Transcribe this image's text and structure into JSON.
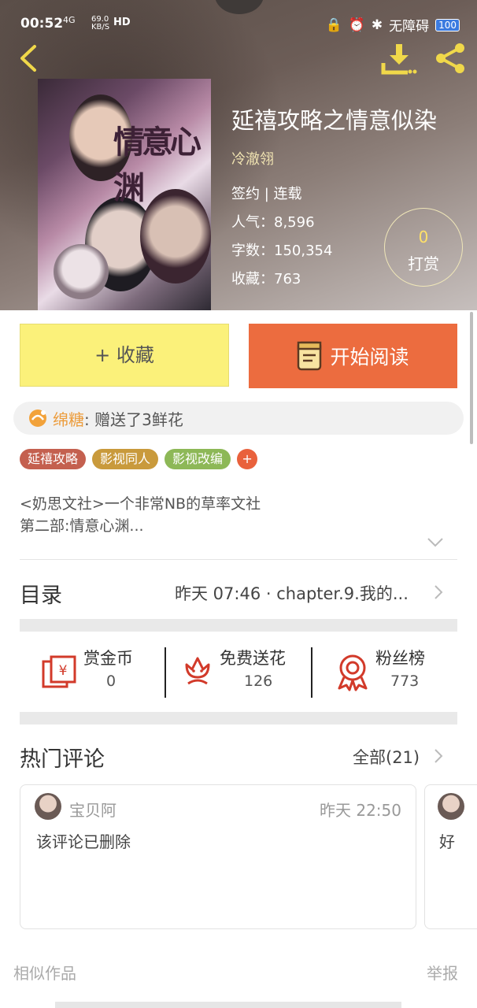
{
  "status_bar": {
    "time": "00:52",
    "network": "4G",
    "speed": "69.0\nKB/S",
    "hd": "HD",
    "ime": "无障碍",
    "battery": "100"
  },
  "header": {
    "back_icon": "back-arrow-icon",
    "download_icon": "download-icon",
    "share_icon": "share-icon"
  },
  "book": {
    "title": "延禧攻略之情意似染",
    "author": "冷澈翎",
    "status": "签约 | 连载",
    "popularity": "人气：8,596",
    "word_count": "字数：150,354",
    "favorites": "收藏：763",
    "tip_count": "0",
    "tip_label": "打赏",
    "cover_text": "情意心渊"
  },
  "actions": {
    "favorite_label": "+ 收藏",
    "read_label": "开始阅读"
  },
  "gift": {
    "user": "绵糖",
    "text": " : 赠送了3鲜花"
  },
  "tags": [
    {
      "label": "延禧攻略",
      "color": "#c4604f"
    },
    {
      "label": "影视同人",
      "color": "#c99a3c"
    },
    {
      "label": "影视改编",
      "color": "#8db857"
    }
  ],
  "tag_add": "+",
  "description": "<奶思文社>一个非常NB的草率文社\n第二部:情意心渊...",
  "toc": {
    "label": "目录",
    "latest": "昨天 07:46 · chapter.9.我的..."
  },
  "stats": [
    {
      "label": "赏金币",
      "value": "0",
      "icon": "coin-reward-icon"
    },
    {
      "label": "免费送花",
      "value": "126",
      "icon": "flower-icon"
    },
    {
      "label": "粉丝榜",
      "value": "773",
      "icon": "medal-icon"
    }
  ],
  "comments": {
    "label": "热门评论",
    "all": "全部(21)",
    "items": [
      {
        "user": "宝贝阿",
        "time": "昨天 22:50",
        "text": "该评论已删除"
      },
      {
        "text": "好"
      }
    ]
  },
  "footer": {
    "similar": "相似作品",
    "report": "举报"
  },
  "colors": {
    "accent_orange": "#ec6c3f",
    "accent_yellow": "#fbf17a",
    "gold": "#f0d84a"
  }
}
